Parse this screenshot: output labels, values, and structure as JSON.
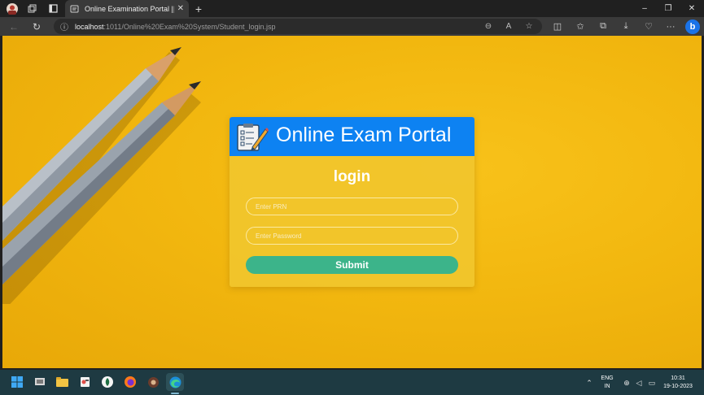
{
  "browser": {
    "tab": {
      "title": "Online Examination Portal || Proje",
      "close_glyph": "✕"
    },
    "new_tab_glyph": "+",
    "window_controls": [
      "–",
      "❐",
      "✕"
    ],
    "address": {
      "host": "localhost",
      "path": ":1011/Online%20Exam%20System/Student_login.jsp"
    },
    "bing_label": "b"
  },
  "page": {
    "portal_title": "Online Exam Portal",
    "login_heading": "login",
    "prn_placeholder": "Enter PRN",
    "password_placeholder": "Enter Password",
    "submit_label": "Submit",
    "colors": {
      "background": "#f2b70f",
      "header": "#0d82f2",
      "submit": "#3cb48a"
    }
  },
  "taskbar": {
    "language": "ENG",
    "region": "IN",
    "time": "10:31",
    "date": "19-10-2023"
  }
}
